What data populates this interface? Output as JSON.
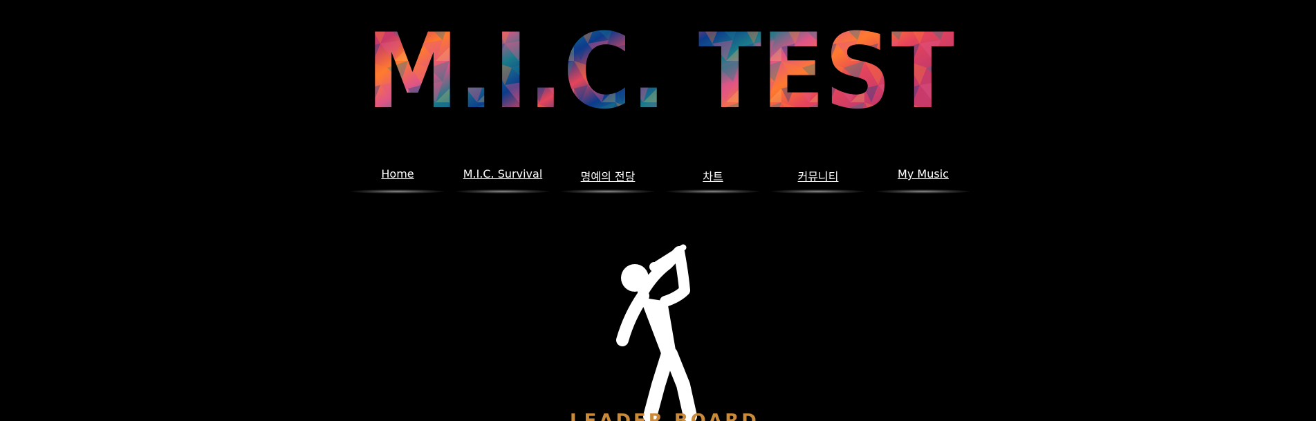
{
  "logo": {
    "text": "M.I.C. TEST",
    "icon": "colorful-mosaic-logo-text"
  },
  "nav": {
    "items": [
      {
        "label": "Home"
      },
      {
        "label": "M.I.C. Survival"
      },
      {
        "label": "명예의 전당"
      },
      {
        "label": "차트"
      },
      {
        "label": "커뮤니티"
      },
      {
        "label": "My Music"
      }
    ]
  },
  "hero": {
    "icon": "singer-with-microphone-icon"
  },
  "leaderboard": {
    "title": "LEADER BOARD"
  },
  "colors": {
    "background": "#000000",
    "nav_text": "#ffffff",
    "leaderboard_title": "#c98a3b",
    "logo_palette": [
      "#e6455a",
      "#ff7a2e",
      "#1a7a8a",
      "#0d3b8c",
      "#e05586"
    ]
  }
}
